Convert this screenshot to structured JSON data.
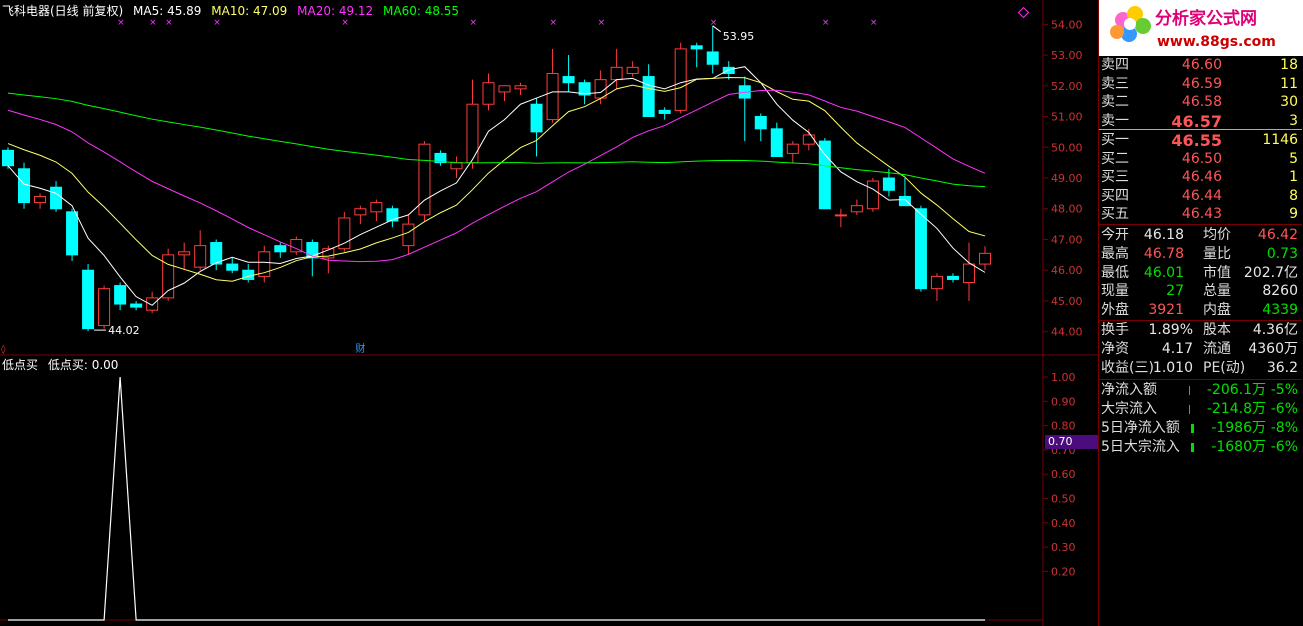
{
  "chart": {
    "title": "飞科电器(日线 前复权)",
    "ma": [
      {
        "label": "MA5: 45.89",
        "color": "#ffffff"
      },
      {
        "label": "MA10: 47.09",
        "color": "#ffff66"
      },
      {
        "label": "MA20: 49.12",
        "color": "#ff33ff"
      },
      {
        "label": "MA60: 48.55",
        "color": "#00ff00"
      }
    ],
    "y_ticks": [
      "54.00",
      "53.00",
      "52.00",
      "51.00",
      "50.00",
      "49.00",
      "48.00",
      "47.00",
      "46.00",
      "45.00",
      "44.00"
    ],
    "y_range": [
      43.6,
      54.4
    ],
    "high_label": "53.95",
    "low_label": "44.02",
    "finance_marker": "财",
    "colors": {
      "up": "#ff3c3c",
      "down": "#00ffff",
      "bg": "#000000",
      "grid": "#7a0000"
    }
  },
  "chart_data": {
    "type": "candlestick",
    "candles": [
      {
        "o": 49.9,
        "h": 50.0,
        "l": 49.3,
        "c": 49.4
      },
      {
        "o": 49.3,
        "h": 49.5,
        "l": 48.0,
        "c": 48.2
      },
      {
        "o": 48.2,
        "h": 48.5,
        "l": 48.0,
        "c": 48.4
      },
      {
        "o": 48.7,
        "h": 48.9,
        "l": 47.9,
        "c": 48.0
      },
      {
        "o": 47.9,
        "h": 48.0,
        "l": 46.3,
        "c": 46.5
      },
      {
        "o": 46.0,
        "h": 46.2,
        "l": 44.02,
        "c": 44.1
      },
      {
        "o": 44.2,
        "h": 45.5,
        "l": 44.1,
        "c": 45.4
      },
      {
        "o": 45.5,
        "h": 45.6,
        "l": 44.7,
        "c": 44.9
      },
      {
        "o": 44.9,
        "h": 45.0,
        "l": 44.7,
        "c": 44.8
      },
      {
        "o": 44.7,
        "h": 45.3,
        "l": 44.6,
        "c": 45.1
      },
      {
        "o": 45.1,
        "h": 46.7,
        "l": 45.0,
        "c": 46.5
      },
      {
        "o": 46.5,
        "h": 46.9,
        "l": 46.0,
        "c": 46.6
      },
      {
        "o": 46.1,
        "h": 47.3,
        "l": 46.0,
        "c": 46.8
      },
      {
        "o": 46.9,
        "h": 47.0,
        "l": 46.0,
        "c": 46.2
      },
      {
        "o": 46.2,
        "h": 46.4,
        "l": 45.9,
        "c": 46.0
      },
      {
        "o": 46.0,
        "h": 46.2,
        "l": 45.6,
        "c": 45.7
      },
      {
        "o": 45.8,
        "h": 46.8,
        "l": 45.6,
        "c": 46.6
      },
      {
        "o": 46.8,
        "h": 46.9,
        "l": 46.4,
        "c": 46.6
      },
      {
        "o": 46.6,
        "h": 47.1,
        "l": 46.5,
        "c": 47.0
      },
      {
        "o": 46.9,
        "h": 47.0,
        "l": 45.8,
        "c": 46.4
      },
      {
        "o": 46.4,
        "h": 46.8,
        "l": 45.9,
        "c": 46.7
      },
      {
        "o": 46.7,
        "h": 47.9,
        "l": 46.6,
        "c": 47.7
      },
      {
        "o": 47.8,
        "h": 48.1,
        "l": 47.5,
        "c": 48.0
      },
      {
        "o": 47.9,
        "h": 48.3,
        "l": 47.6,
        "c": 48.2
      },
      {
        "o": 48.0,
        "h": 48.1,
        "l": 47.4,
        "c": 47.6
      },
      {
        "o": 46.8,
        "h": 47.8,
        "l": 46.5,
        "c": 47.5
      },
      {
        "o": 47.8,
        "h": 50.2,
        "l": 47.6,
        "c": 50.1
      },
      {
        "o": 49.8,
        "h": 49.9,
        "l": 49.4,
        "c": 49.5
      },
      {
        "o": 49.3,
        "h": 49.7,
        "l": 49.0,
        "c": 49.5
      },
      {
        "o": 49.5,
        "h": 52.2,
        "l": 49.3,
        "c": 51.4
      },
      {
        "o": 51.4,
        "h": 52.4,
        "l": 51.2,
        "c": 52.1
      },
      {
        "o": 51.8,
        "h": 52.0,
        "l": 51.5,
        "c": 52.0
      },
      {
        "o": 51.9,
        "h": 52.1,
        "l": 51.7,
        "c": 52.0
      },
      {
        "o": 51.4,
        "h": 51.6,
        "l": 49.7,
        "c": 50.5
      },
      {
        "o": 50.9,
        "h": 53.2,
        "l": 50.8,
        "c": 52.4
      },
      {
        "o": 52.3,
        "h": 53.0,
        "l": 51.8,
        "c": 52.1
      },
      {
        "o": 52.1,
        "h": 52.2,
        "l": 51.4,
        "c": 51.7
      },
      {
        "o": 51.6,
        "h": 52.5,
        "l": 51.4,
        "c": 52.2
      },
      {
        "o": 52.2,
        "h": 53.2,
        "l": 51.9,
        "c": 52.6
      },
      {
        "o": 52.4,
        "h": 52.8,
        "l": 52.3,
        "c": 52.6
      },
      {
        "o": 52.3,
        "h": 52.7,
        "l": 51.8,
        "c": 51.0
      },
      {
        "o": 51.2,
        "h": 51.3,
        "l": 50.9,
        "c": 51.1
      },
      {
        "o": 51.2,
        "h": 53.4,
        "l": 51.1,
        "c": 53.2
      },
      {
        "o": 53.3,
        "h": 53.4,
        "l": 52.6,
        "c": 53.2
      },
      {
        "o": 53.1,
        "h": 53.95,
        "l": 52.4,
        "c": 52.7
      },
      {
        "o": 52.6,
        "h": 52.8,
        "l": 52.2,
        "c": 52.4
      },
      {
        "o": 52.0,
        "h": 52.3,
        "l": 50.2,
        "c": 51.6
      },
      {
        "o": 51.0,
        "h": 51.1,
        "l": 50.2,
        "c": 50.6
      },
      {
        "o": 50.6,
        "h": 50.8,
        "l": 49.7,
        "c": 49.7
      },
      {
        "o": 49.8,
        "h": 50.2,
        "l": 49.5,
        "c": 50.1
      },
      {
        "o": 50.1,
        "h": 50.6,
        "l": 49.9,
        "c": 50.4
      },
      {
        "o": 50.2,
        "h": 50.3,
        "l": 48.0,
        "c": 48.0
      },
      {
        "o": 47.8,
        "h": 48.0,
        "l": 47.4,
        "c": 47.8
      },
      {
        "o": 47.9,
        "h": 48.3,
        "l": 47.8,
        "c": 48.1
      },
      {
        "o": 48.0,
        "h": 49.0,
        "l": 47.9,
        "c": 48.9
      },
      {
        "o": 49.0,
        "h": 49.3,
        "l": 48.4,
        "c": 48.6
      },
      {
        "o": 48.4,
        "h": 49.0,
        "l": 48.2,
        "c": 48.1
      },
      {
        "o": 48.0,
        "h": 48.1,
        "l": 45.3,
        "c": 45.4
      },
      {
        "o": 45.4,
        "h": 45.9,
        "l": 45.0,
        "c": 45.8
      },
      {
        "o": 45.8,
        "h": 45.9,
        "l": 45.6,
        "c": 45.7
      },
      {
        "o": 45.6,
        "h": 46.9,
        "l": 45.0,
        "c": 46.2
      },
      {
        "o": 46.2,
        "h": 46.78,
        "l": 46.01,
        "c": 46.55
      }
    ],
    "indicator": {
      "name": "低点买",
      "value_label": "低点买: 0.00",
      "values_nonzero_index": 7,
      "y_ticks": [
        "1.00",
        "0.90",
        "0.80",
        "0.70",
        "0.60",
        "0.50",
        "0.40",
        "0.30",
        "0.20"
      ],
      "marker": "0.70"
    }
  },
  "panel": {
    "sell": [
      {
        "label": "卖四",
        "price": "46.60",
        "vol": "18"
      },
      {
        "label": "卖三",
        "price": "46.59",
        "vol": "11"
      },
      {
        "label": "卖二",
        "price": "46.58",
        "vol": "30"
      },
      {
        "label": "卖一",
        "price": "46.57",
        "vol": "3"
      }
    ],
    "buy": [
      {
        "label": "买一",
        "price": "46.55",
        "vol": "1146"
      },
      {
        "label": "买二",
        "price": "46.50",
        "vol": "5"
      },
      {
        "label": "买三",
        "price": "46.46",
        "vol": "1"
      },
      {
        "label": "买四",
        "price": "46.44",
        "vol": "8"
      },
      {
        "label": "买五",
        "price": "46.43",
        "vol": "9"
      }
    ],
    "stats1": [
      {
        "l1": "今开",
        "v1": "46.18",
        "c1": "wht",
        "l2": "均价",
        "v2": "46.42",
        "c2": "red"
      },
      {
        "l1": "最高",
        "v1": "46.78",
        "c1": "red",
        "l2": "量比",
        "v2": "0.73",
        "c2": "grn"
      },
      {
        "l1": "最低",
        "v1": "46.01",
        "c1": "grn",
        "l2": "市值",
        "v2": "202.7亿",
        "c2": "wht"
      },
      {
        "l1": "现量",
        "v1": "27",
        "c1": "grn",
        "l2": "总量",
        "v2": "8260",
        "c2": "wht"
      },
      {
        "l1": "外盘",
        "v1": "3921",
        "c1": "red",
        "l2": "内盘",
        "v2": "4339",
        "c2": "grn"
      }
    ],
    "stats2": [
      {
        "l1": "换手",
        "v1": "1.89%",
        "c1": "wht",
        "l2": "股本",
        "v2": "4.36亿",
        "c2": "wht"
      },
      {
        "l1": "净资",
        "v1": "4.17",
        "c1": "wht",
        "l2": "流通",
        "v2": "4360万",
        "c2": "wht"
      },
      {
        "l1": "收益(三)",
        "v1": "1.010",
        "c1": "wht",
        "l2": "PE(动)",
        "v2": "36.2",
        "c2": "wht"
      }
    ],
    "flows": [
      {
        "label": "净流入额",
        "val": "-206.1万",
        "pct": "-5%"
      },
      {
        "label": "大宗流入",
        "val": "-214.8万",
        "pct": "-6%"
      },
      {
        "label": "5日净流入额",
        "val": "-1986万",
        "pct": "-8%"
      },
      {
        "label": "5日大宗流入",
        "val": "-1680万",
        "pct": "-6%"
      }
    ],
    "logo": {
      "title": "分析家公式网",
      "url": "www.88gs.com"
    }
  }
}
